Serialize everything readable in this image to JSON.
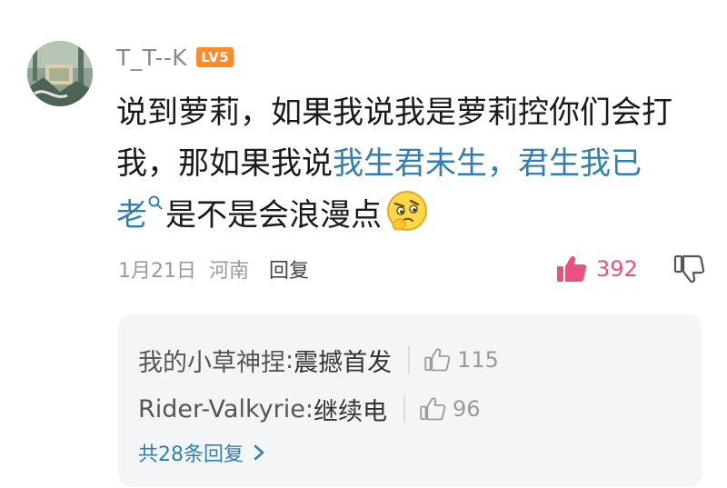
{
  "comment": {
    "username": "T_T--K",
    "level_badge": "LV5",
    "content": {
      "line1": "说到萝莉，如果我说我是萝莉控你们会打",
      "line2_prefix": "我，那如果我说",
      "line2_link": "我生君未生，君生我已",
      "line3_link": "老",
      "line3_suffix": "是不是会浪漫点"
    },
    "meta": {
      "date": "1月21日",
      "location": "河南",
      "reply_label": "回复"
    },
    "likes": "392"
  },
  "replies": {
    "items": [
      {
        "author": "我的小草神捏",
        "text": "震撼首发",
        "likes": "115"
      },
      {
        "author": "Rider-Valkyrie",
        "text": "继续电",
        "likes": "96"
      }
    ],
    "more_label": "共28条回复"
  },
  "colors": {
    "link": "#2f7fb3",
    "like_active": "#e8527f",
    "level_badge": "#ff8a2a"
  }
}
